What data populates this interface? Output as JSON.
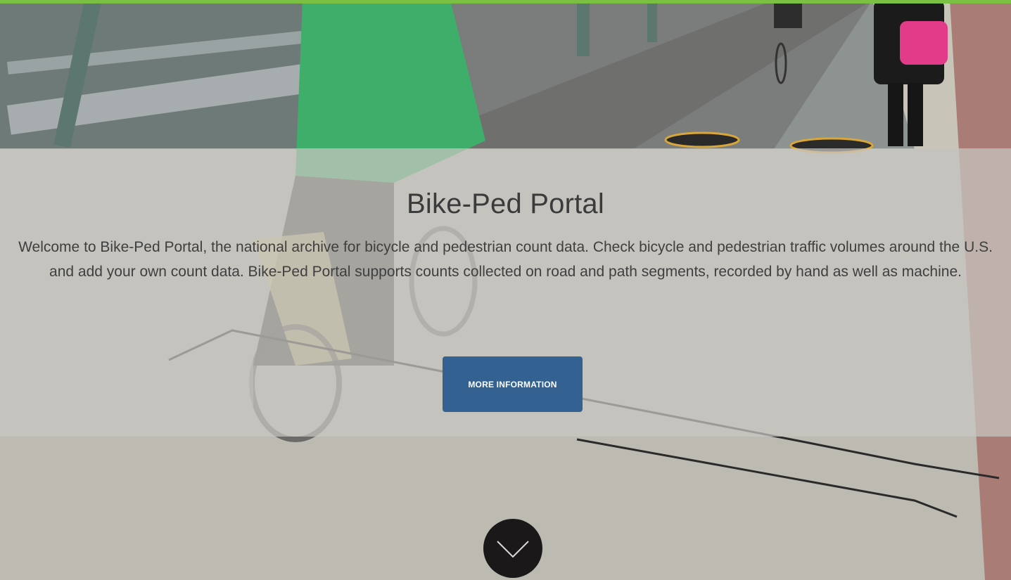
{
  "hero": {
    "title": "Bike-Ped Portal",
    "description": "Welcome to Bike-Ped Portal, the national archive for bicycle and pedestrian count data. Check bicycle and pedestrian traffic volumes around the U.S. and add your own count data. Bike-Ped Portal supports counts collected on road and path segments, recorded by hand as well as machine.",
    "more_button_label": "MORE INFORMATION"
  },
  "icons": {
    "scroll_down": "chevron-down-icon"
  },
  "colors": {
    "accent_bar": "#7bc043",
    "button": "#336191",
    "scroll_circle": "#1a1818"
  }
}
